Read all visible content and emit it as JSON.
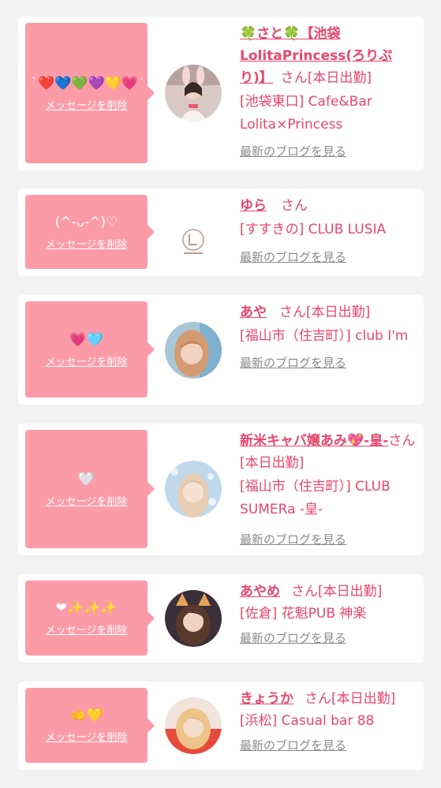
{
  "delete_label": "メッセージを削除",
  "blog_label": "最新のブログを見る",
  "colors": {
    "accent": "#e8466b",
    "bubble": "#fc9ba8",
    "link_gray": "#8a8a8a",
    "background": "#f2f2f2"
  },
  "cards": [
    {
      "emoji": "`❤️💙💚💜💛💗´",
      "name": "🍀さと🍀【池袋LolitaPrincess(ろりぷり)】",
      "suffix": "さん[本日出勤]",
      "shop": "[池袋東口] Cafe&Bar Lolita×Princess"
    },
    {
      "emoji": "(^-ᴗ-^)♡",
      "name": "ゆら",
      "suffix": "さん",
      "shop": "[すすきの] CLUB LUSIA"
    },
    {
      "emoji": "💗🩵",
      "name": "あや",
      "suffix": "さん[本日出勤]",
      "shop": "[福山市（住吉町）] club I'm"
    },
    {
      "emoji": "🤍",
      "name": "新米キャバ嬢あみ💖-皇-",
      "suffix": "さん[本日出勤]",
      "shop": "[福山市（住吉町）] CLUB SUMERa -皇-"
    },
    {
      "emoji": "❤︎✨✨✨",
      "name": "あやめ",
      "suffix": "さん[本日出勤]",
      "shop": "[佐倉] 花魁PUB 神楽"
    },
    {
      "emoji": "🫲💛",
      "name": "きょうか",
      "suffix": "さん[本日出勤]",
      "shop": "[浜松] Casual bar 88"
    }
  ]
}
